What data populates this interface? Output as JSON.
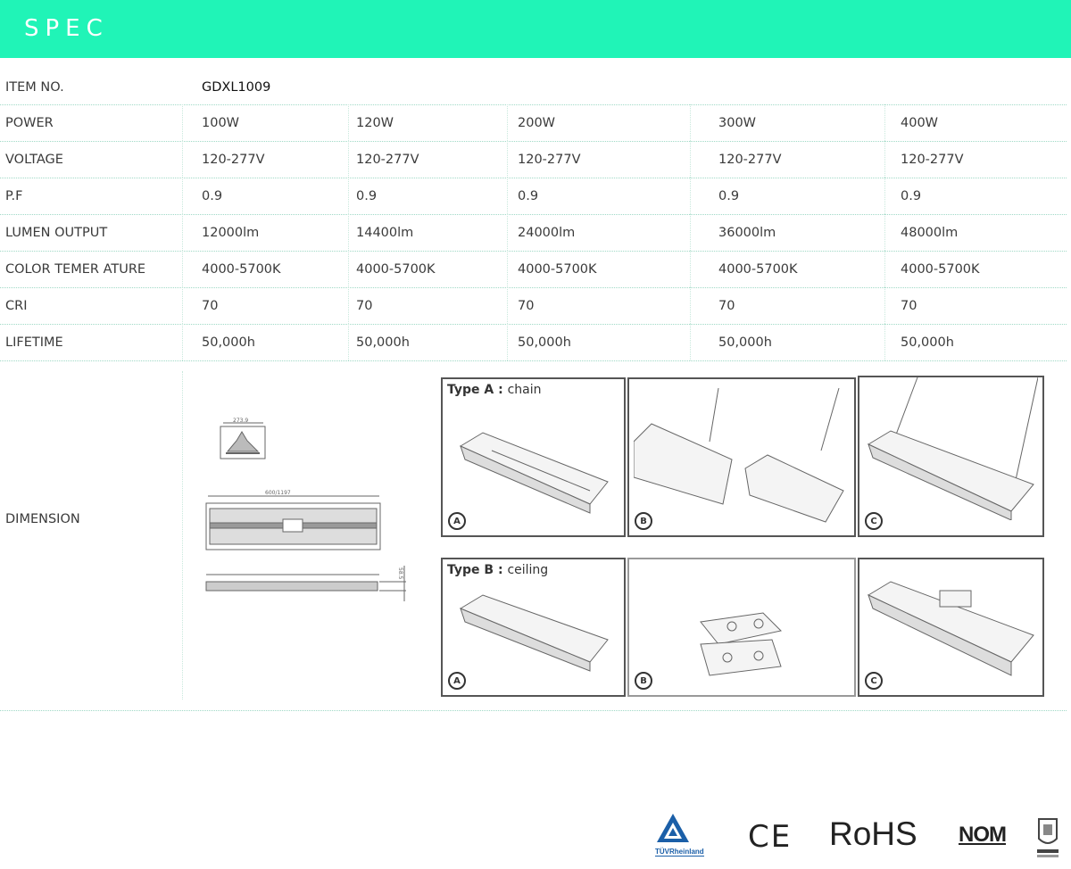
{
  "header": {
    "title": "SPEC"
  },
  "item": {
    "label": "ITEM NO.",
    "value": "GDXL1009"
  },
  "rows": [
    {
      "label": "POWER",
      "values": [
        "100W",
        "120W",
        "200W",
        "300W",
        "400W"
      ]
    },
    {
      "label": "VOLTAGE",
      "values": [
        "120-277V",
        "120-277V",
        "120-277V",
        "120-277V",
        "120-277V"
      ]
    },
    {
      "label": "P.F",
      "values": [
        "0.9",
        "0.9",
        "0.9",
        "0.9",
        "0.9"
      ]
    },
    {
      "label": "LUMEN OUTPUT",
      "values": [
        "12000lm",
        "14400lm",
        "24000lm",
        "36000lm",
        "48000lm"
      ]
    },
    {
      "label": "COLOR TEMER ATURE",
      "values": [
        "4000-5700K",
        "4000-5700K",
        "4000-5700K",
        "4000-5700K",
        "4000-5700K"
      ]
    },
    {
      "label": "CRI",
      "values": [
        "70",
        "70",
        "70",
        "70",
        "70"
      ]
    },
    {
      "label": "LIFETIME",
      "values": [
        "50,000h",
        "50,000h",
        "50,000h",
        "50,000h",
        "50,000h"
      ]
    }
  ],
  "dimension": {
    "label": "DIMENSION",
    "type_a": {
      "title": "Type A :",
      "sub": "chain"
    },
    "type_b": {
      "title": "Type B :",
      "sub": "ceiling"
    },
    "tags": [
      "A",
      "B",
      "C"
    ]
  },
  "certifications": {
    "tuv": "TÜVRheinland",
    "ce": "CE",
    "rohs": "RoHS",
    "nom": "NOM"
  },
  "colors": {
    "accent": "#20f4b7"
  }
}
